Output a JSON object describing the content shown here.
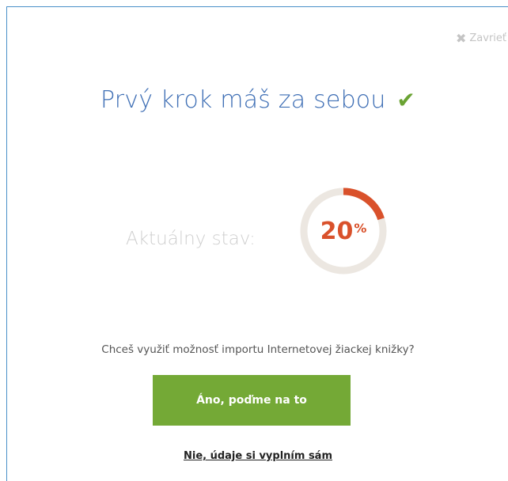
{
  "header": {
    "close_label": "Zavrieť",
    "close_icon": "close-icon"
  },
  "main": {
    "title": "Prvý krok máš za sebou",
    "title_icon": "checkmark-icon",
    "status_label": "Aktuálny stav:",
    "progress": {
      "value": 20,
      "unit": "%"
    },
    "question": "Chceš využiť možnosť importu Internetovej žiackej knižky?",
    "primary_button": "Áno, poďme na to",
    "secondary_link": "Nie, údaje si vyplním sám"
  },
  "colors": {
    "title": "#3f6fb5",
    "check": "#6aa333",
    "progress_fill": "#d9512b",
    "progress_track": "#ece7e1",
    "button_bg": "#74a936"
  }
}
